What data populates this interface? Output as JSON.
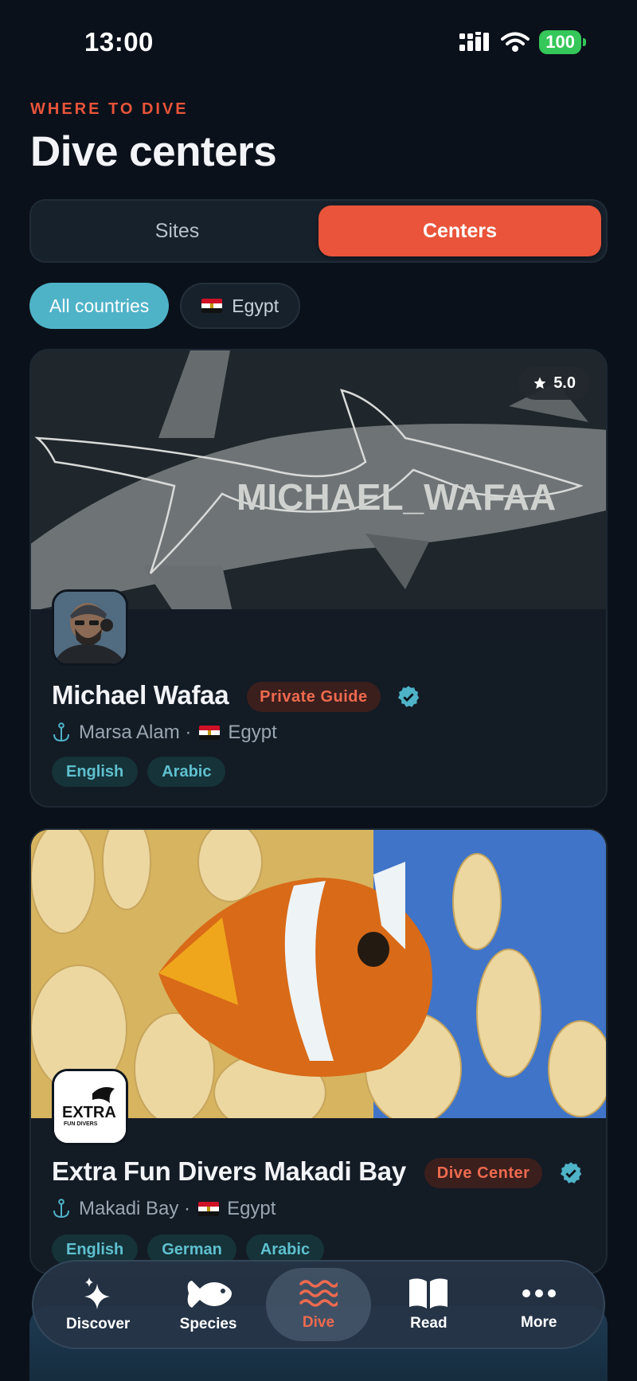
{
  "status_bar": {
    "time": "13:00",
    "battery": "100"
  },
  "header": {
    "eyebrow": "WHERE TO DIVE",
    "title": "Dive centers"
  },
  "segmented": {
    "sites_label": "Sites",
    "centers_label": "Centers",
    "selected": "Centers"
  },
  "filters": {
    "all_label": "All countries",
    "egypt_label": "Egypt"
  },
  "cards": [
    {
      "rating": "5.0",
      "image_watermark": "MICHAEL_WAFAA",
      "name": "Michael Wafaa",
      "badge": "Private Guide",
      "location": "Marsa Alam ·",
      "country": "Egypt",
      "languages": [
        "English",
        "Arabic"
      ],
      "verified": true
    },
    {
      "name": "Extra Fun Divers Makadi Bay",
      "logo_text": "EXTRA",
      "logo_subtext": "FUN DIVERS",
      "badge": "Dive Center",
      "location": "Makadi Bay ·",
      "country": "Egypt",
      "languages": [
        "English",
        "German",
        "Arabic"
      ],
      "verified": true
    }
  ],
  "tabbar": {
    "items": [
      {
        "label": "Discover",
        "icon": "sparkles-icon"
      },
      {
        "label": "Species",
        "icon": "fish-icon"
      },
      {
        "label": "Dive",
        "icon": "waves-icon"
      },
      {
        "label": "Read",
        "icon": "book-icon"
      },
      {
        "label": "More",
        "icon": "ellipsis-icon"
      }
    ],
    "active": "Dive"
  },
  "colors": {
    "accent": "#e9543a",
    "teal": "#4fb3c8",
    "background": "#0b111a"
  }
}
